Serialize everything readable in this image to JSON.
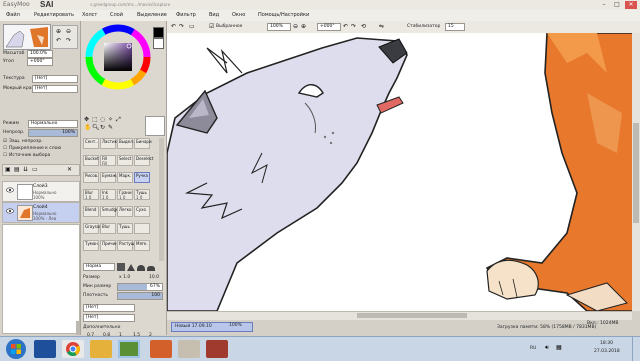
{
  "titlebar": {
    "logo": "EasyMoo",
    "app": "SAI",
    "url": "s.greedgroup.com/ms.../movie/i/capture",
    "minimize": "–",
    "maximize": "□",
    "close": "✕"
  },
  "menu": [
    "Файл",
    "Редактировать",
    "Холст",
    "Слой",
    "Выделение",
    "Фильтр",
    "Вид",
    "Окно",
    "Помощь/Настройки"
  ],
  "navigator": {
    "zoom_label": "Масштаб",
    "zoom_value": "100.0%",
    "angle_label": "Угол",
    "angle_value": "+000°"
  },
  "layer_panel": {
    "texture_label": "Текстура",
    "texture_value": "[Нет]",
    "effect_label": "Мокрый край",
    "effect_value": "[Нет]",
    "mode_label": "Режим",
    "mode_value": "Нормально",
    "opacity_label": "Непрозр.",
    "opacity_value": "100%",
    "checks": [
      "Защ. непрозр.",
      "Прикрепление к слою",
      "Источник выбора"
    ],
    "layers": [
      {
        "name": "Слой3",
        "mode": "Нормально",
        "opacity": "100%"
      },
      {
        "name": "Слой4",
        "mode": "Нормально",
        "opacity": "100% · Лев"
      }
    ]
  },
  "tools": [
    [
      "Сент..",
      "Ластик",
      "Выдел.",
      "Бинари"
    ],
    [
      "Bucket",
      "Fill",
      "Select",
      "Deselect"
    ],
    [
      "Рисов.",
      "Бумаж.",
      "Марк.",
      "Ручка"
    ],
    [
      "Blur",
      "Ink",
      "Грани",
      "Тушь"
    ],
    [
      "Blend",
      "Smudge",
      "Легко",
      "Сухо"
    ],
    [
      "Grayson",
      "Blur",
      "Тушь",
      ""
    ],
    [
      "Туман",
      "Причин.",
      "Растуш.",
      "Мягк."
    ]
  ],
  "tool_subs": [
    [
      "",
      "",
      "",
      ""
    ],
    [
      "",
      "Fill",
      "",
      ""
    ],
    [
      "",
      "",
      "",
      ""
    ],
    [
      "1 0",
      "1 0",
      "1 0",
      "1 0"
    ],
    [
      "",
      "",
      "",
      ""
    ],
    [
      "",
      "",
      "",
      ""
    ],
    [
      "",
      "",
      "",
      ""
    ]
  ],
  "brush": {
    "mode_value": "Норма",
    "size_label": "Размер",
    "size_mult": "х 1.0",
    "size_value": "10.0",
    "minsize_label": "Мин размер",
    "minsize_value": "67%",
    "density_label": "Плотность",
    "density_value": "100",
    "shape_value": "[Нет]",
    "texture_value": "[Нет]",
    "adv_label": "Дополнительно",
    "presets": [
      "0.7",
      "0.8",
      "1",
      "1.5",
      "2"
    ]
  },
  "canvasbar": {
    "selection_check": "Выбранное",
    "zoom": "100%",
    "angle": "+000°",
    "stabilizer_label": "Стабилизатор",
    "stabilizer_value": "15"
  },
  "statusbar": {
    "doc_tab": "Новый 17.09.10",
    "doc_zoom": "100%",
    "memory": "Загрузка памяти: 58% (1758MB / 7831MB)",
    "drive": "Вкл.: 1024MB"
  },
  "taskbar": {
    "lang": "RU",
    "time": "18:30",
    "date": "27.03.2018"
  },
  "colors": {
    "accent": "#c7d2f3",
    "bg": "#d4d0c8",
    "canvas": "#ffffff"
  }
}
